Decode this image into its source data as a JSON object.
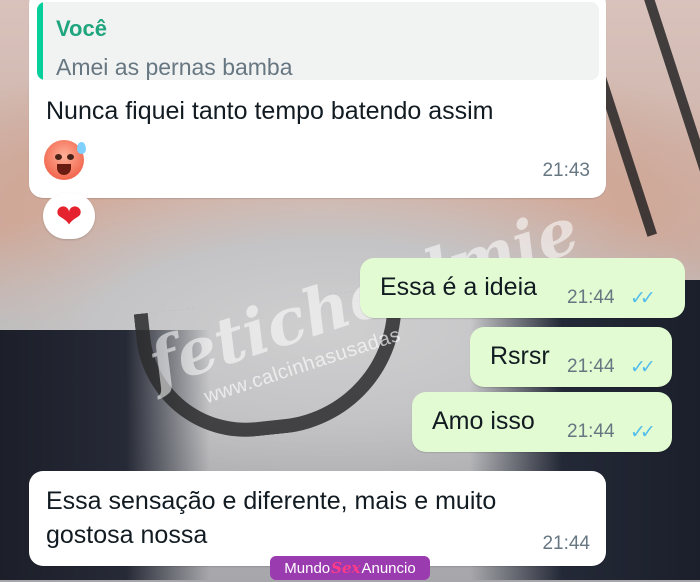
{
  "chat": {
    "messages": [
      {
        "direction": "incoming",
        "quote": {
          "author": "Você",
          "text": "Amei as pernas bamba"
        },
        "text": "Nunca fiquei tanto tempo batendo assim",
        "emoji": "hot-face-emoji",
        "time": "21:43",
        "reaction": "❤"
      },
      {
        "direction": "outgoing",
        "text": "Essa é a ideia",
        "time": "21:44",
        "status": "✓✓"
      },
      {
        "direction": "outgoing",
        "text": "Rsrsr",
        "time": "21:44",
        "status": "✓✓"
      },
      {
        "direction": "outgoing",
        "text": "Amo isso",
        "time": "21:44",
        "status": "✓✓"
      },
      {
        "direction": "incoming",
        "text": "Essa sensação e diferente, mais e muito gostosa nossa",
        "time": "21:44"
      }
    ]
  },
  "watermark": {
    "script": "fetichealmie",
    "url": "www.calcinhasusadas"
  },
  "badge": {
    "left": "Mundo",
    "middle": "Sex",
    "right": "Anuncio"
  },
  "colors": {
    "incoming_bubble": "#ffffff",
    "outgoing_bubble": "#e2fbd2",
    "quote_author": "#1fa67e",
    "read_ticks": "#53bdeb",
    "reaction_heart": "#e5232f",
    "badge_bg": "#9b3bb0"
  }
}
